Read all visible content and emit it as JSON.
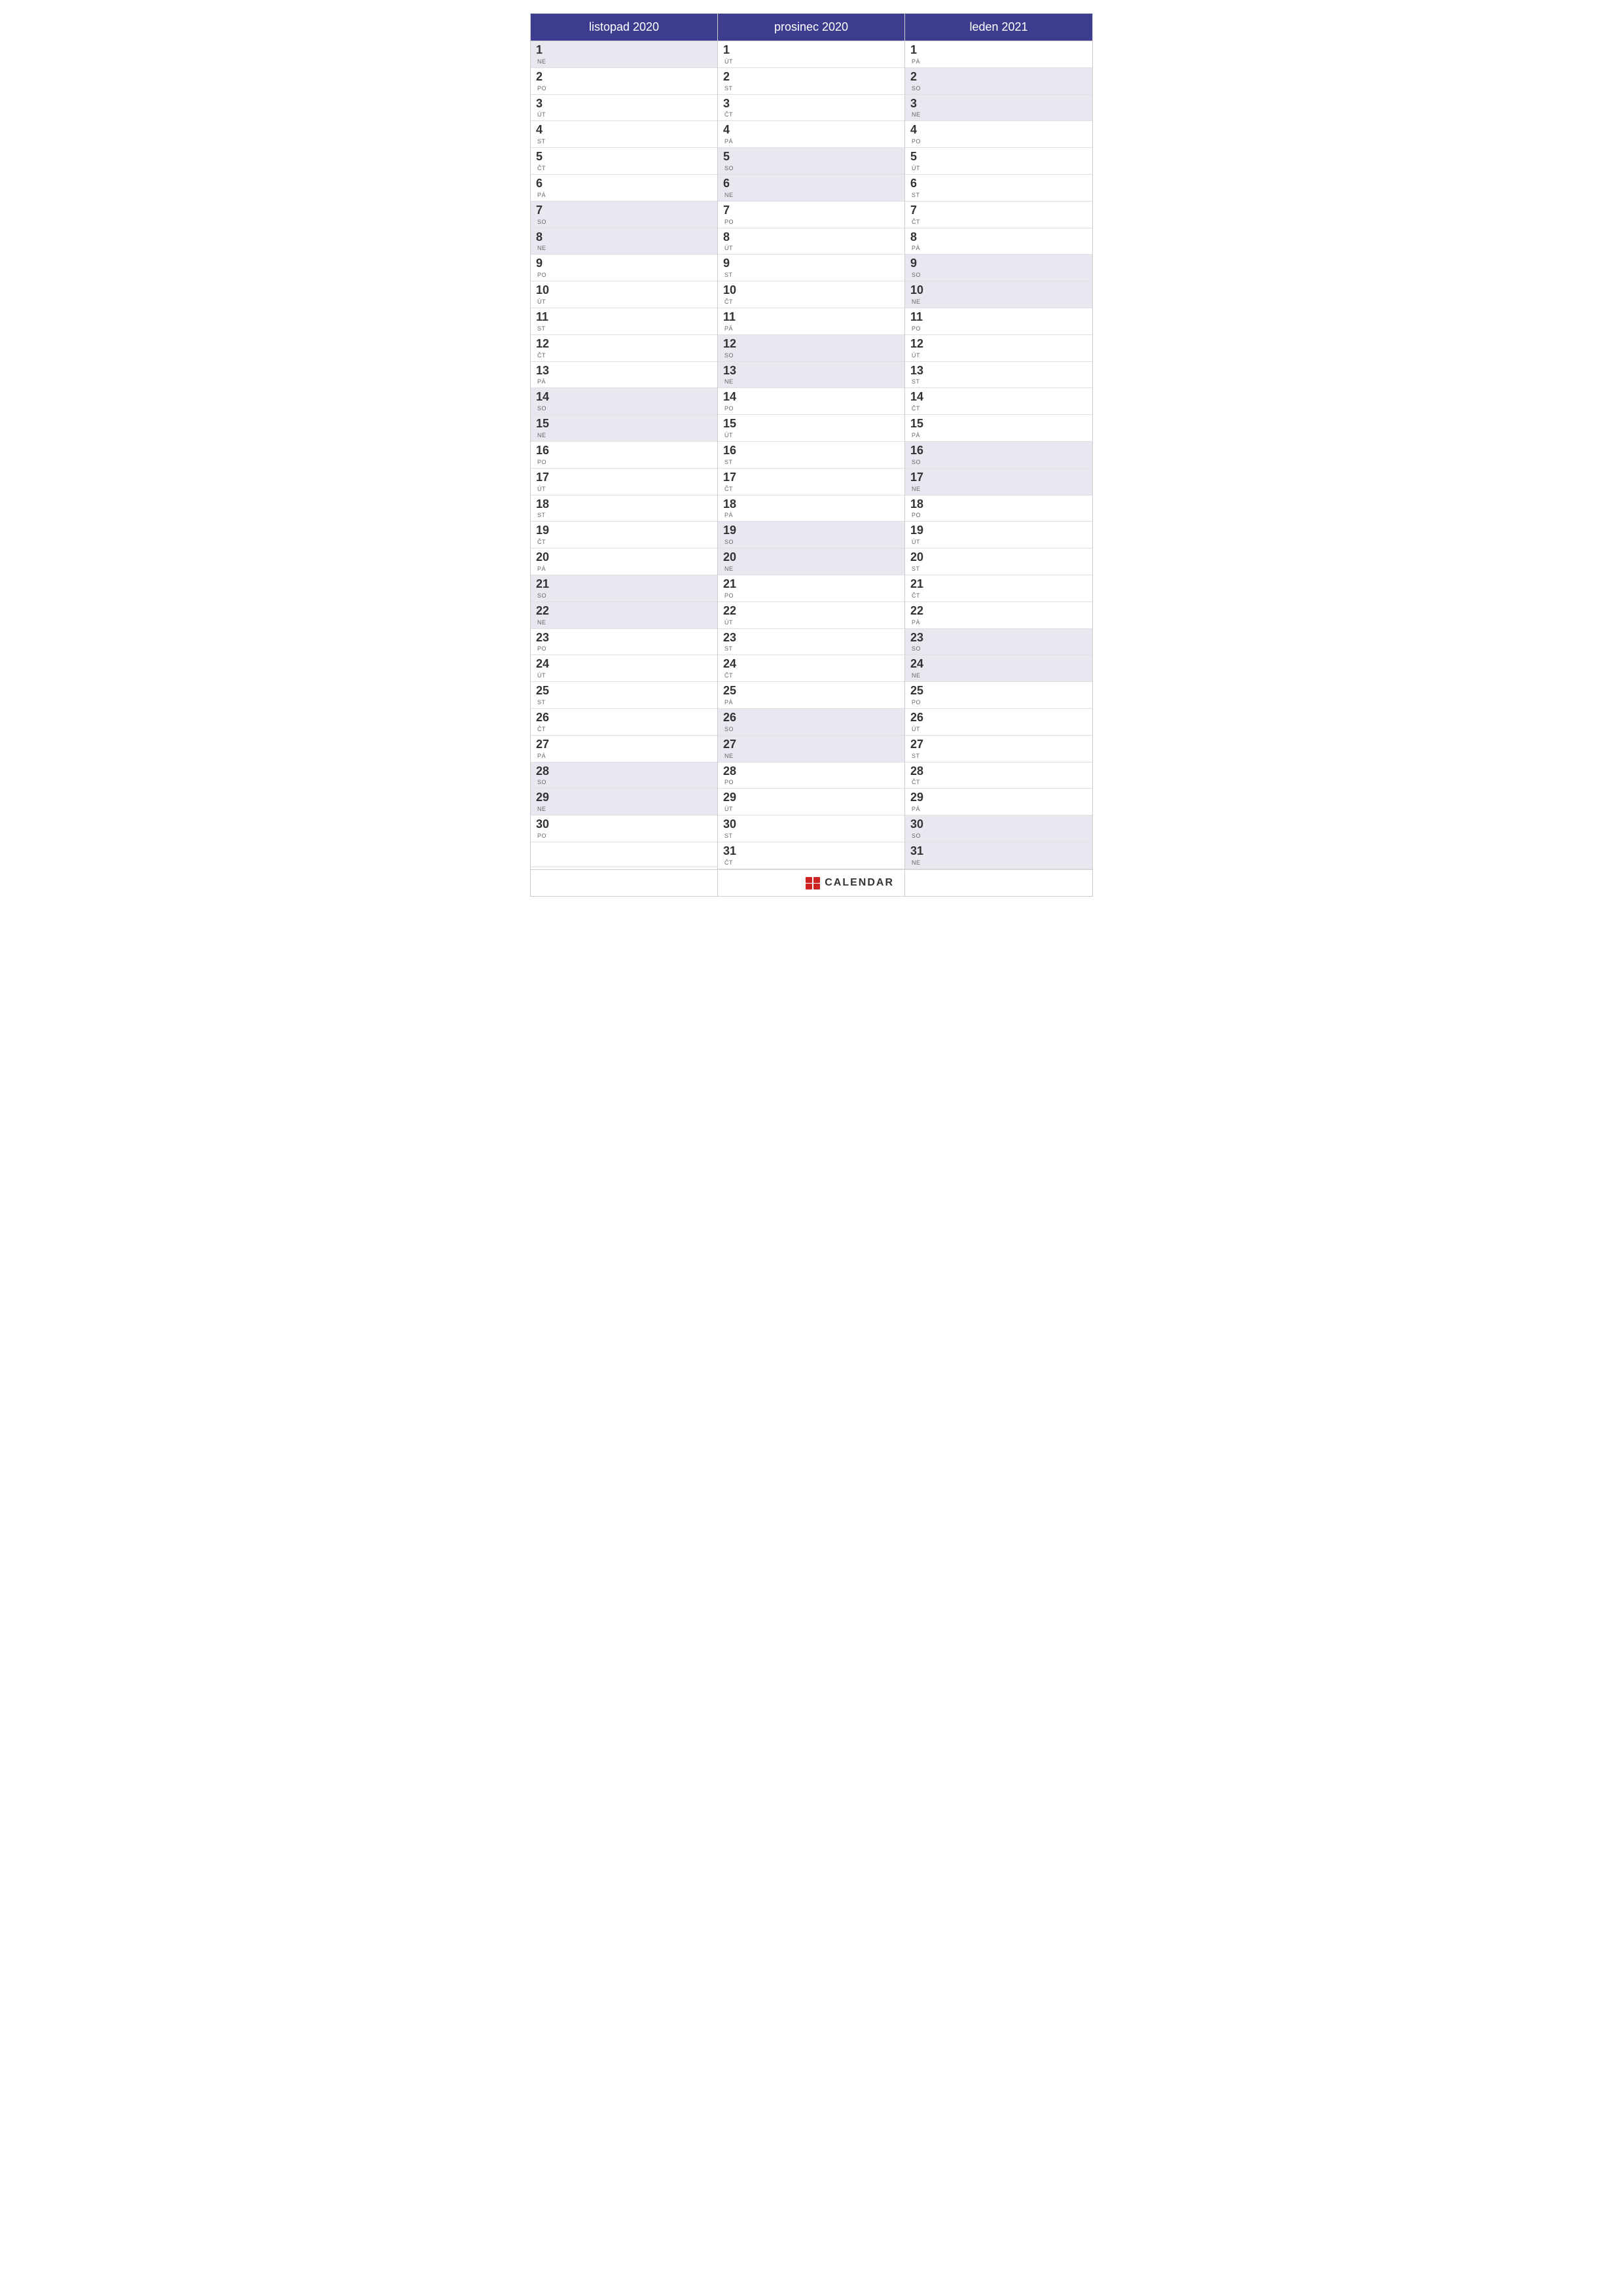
{
  "months": [
    {
      "name": "listopad 2020",
      "days": [
        {
          "num": "1",
          "name": "NE",
          "weekend": true
        },
        {
          "num": "2",
          "name": "PO",
          "weekend": false
        },
        {
          "num": "3",
          "name": "ÚT",
          "weekend": false
        },
        {
          "num": "4",
          "name": "ST",
          "weekend": false
        },
        {
          "num": "5",
          "name": "ČT",
          "weekend": false
        },
        {
          "num": "6",
          "name": "PÁ",
          "weekend": false
        },
        {
          "num": "7",
          "name": "SO",
          "weekend": true
        },
        {
          "num": "8",
          "name": "NE",
          "weekend": true
        },
        {
          "num": "9",
          "name": "PO",
          "weekend": false
        },
        {
          "num": "10",
          "name": "ÚT",
          "weekend": false
        },
        {
          "num": "11",
          "name": "ST",
          "weekend": false
        },
        {
          "num": "12",
          "name": "ČT",
          "weekend": false
        },
        {
          "num": "13",
          "name": "PÁ",
          "weekend": false
        },
        {
          "num": "14",
          "name": "SO",
          "weekend": true
        },
        {
          "num": "15",
          "name": "NE",
          "weekend": true
        },
        {
          "num": "16",
          "name": "PO",
          "weekend": false
        },
        {
          "num": "17",
          "name": "ÚT",
          "weekend": false
        },
        {
          "num": "18",
          "name": "ST",
          "weekend": false
        },
        {
          "num": "19",
          "name": "ČT",
          "weekend": false
        },
        {
          "num": "20",
          "name": "PÁ",
          "weekend": false
        },
        {
          "num": "21",
          "name": "SO",
          "weekend": true
        },
        {
          "num": "22",
          "name": "NE",
          "weekend": true
        },
        {
          "num": "23",
          "name": "PO",
          "weekend": false
        },
        {
          "num": "24",
          "name": "ÚT",
          "weekend": false
        },
        {
          "num": "25",
          "name": "ST",
          "weekend": false
        },
        {
          "num": "26",
          "name": "ČT",
          "weekend": false
        },
        {
          "num": "27",
          "name": "PÁ",
          "weekend": false
        },
        {
          "num": "28",
          "name": "SO",
          "weekend": true
        },
        {
          "num": "29",
          "name": "NE",
          "weekend": true
        },
        {
          "num": "30",
          "name": "PO",
          "weekend": false
        }
      ],
      "extraDays": 1
    },
    {
      "name": "prosinec 2020",
      "days": [
        {
          "num": "1",
          "name": "ÚT",
          "weekend": false
        },
        {
          "num": "2",
          "name": "ST",
          "weekend": false
        },
        {
          "num": "3",
          "name": "ČT",
          "weekend": false
        },
        {
          "num": "4",
          "name": "PÁ",
          "weekend": false
        },
        {
          "num": "5",
          "name": "SO",
          "weekend": true
        },
        {
          "num": "6",
          "name": "NE",
          "weekend": true
        },
        {
          "num": "7",
          "name": "PO",
          "weekend": false
        },
        {
          "num": "8",
          "name": "ÚT",
          "weekend": false
        },
        {
          "num": "9",
          "name": "ST",
          "weekend": false
        },
        {
          "num": "10",
          "name": "ČT",
          "weekend": false
        },
        {
          "num": "11",
          "name": "PÁ",
          "weekend": false
        },
        {
          "num": "12",
          "name": "SO",
          "weekend": true
        },
        {
          "num": "13",
          "name": "NE",
          "weekend": true
        },
        {
          "num": "14",
          "name": "PO",
          "weekend": false
        },
        {
          "num": "15",
          "name": "ÚT",
          "weekend": false
        },
        {
          "num": "16",
          "name": "ST",
          "weekend": false
        },
        {
          "num": "17",
          "name": "ČT",
          "weekend": false
        },
        {
          "num": "18",
          "name": "PÁ",
          "weekend": false
        },
        {
          "num": "19",
          "name": "SO",
          "weekend": true
        },
        {
          "num": "20",
          "name": "NE",
          "weekend": true
        },
        {
          "num": "21",
          "name": "PO",
          "weekend": false
        },
        {
          "num": "22",
          "name": "ÚT",
          "weekend": false
        },
        {
          "num": "23",
          "name": "ST",
          "weekend": false
        },
        {
          "num": "24",
          "name": "ČT",
          "weekend": false
        },
        {
          "num": "25",
          "name": "PÁ",
          "weekend": false
        },
        {
          "num": "26",
          "name": "SO",
          "weekend": true
        },
        {
          "num": "27",
          "name": "NE",
          "weekend": true
        },
        {
          "num": "28",
          "name": "PO",
          "weekend": false
        },
        {
          "num": "29",
          "name": "ÚT",
          "weekend": false
        },
        {
          "num": "30",
          "name": "ST",
          "weekend": false
        },
        {
          "num": "31",
          "name": "ČT",
          "weekend": false
        }
      ],
      "extraDays": 0
    },
    {
      "name": "leden 2021",
      "days": [
        {
          "num": "1",
          "name": "PÁ",
          "weekend": false
        },
        {
          "num": "2",
          "name": "SO",
          "weekend": true
        },
        {
          "num": "3",
          "name": "NE",
          "weekend": true
        },
        {
          "num": "4",
          "name": "PO",
          "weekend": false
        },
        {
          "num": "5",
          "name": "ÚT",
          "weekend": false
        },
        {
          "num": "6",
          "name": "ST",
          "weekend": false
        },
        {
          "num": "7",
          "name": "ČT",
          "weekend": false
        },
        {
          "num": "8",
          "name": "PÁ",
          "weekend": false
        },
        {
          "num": "9",
          "name": "SO",
          "weekend": true
        },
        {
          "num": "10",
          "name": "NE",
          "weekend": true
        },
        {
          "num": "11",
          "name": "PO",
          "weekend": false
        },
        {
          "num": "12",
          "name": "ÚT",
          "weekend": false
        },
        {
          "num": "13",
          "name": "ST",
          "weekend": false
        },
        {
          "num": "14",
          "name": "ČT",
          "weekend": false
        },
        {
          "num": "15",
          "name": "PÁ",
          "weekend": false
        },
        {
          "num": "16",
          "name": "SO",
          "weekend": true
        },
        {
          "num": "17",
          "name": "NE",
          "weekend": true
        },
        {
          "num": "18",
          "name": "PO",
          "weekend": false
        },
        {
          "num": "19",
          "name": "ÚT",
          "weekend": false
        },
        {
          "num": "20",
          "name": "ST",
          "weekend": false
        },
        {
          "num": "21",
          "name": "ČT",
          "weekend": false
        },
        {
          "num": "22",
          "name": "PÁ",
          "weekend": false
        },
        {
          "num": "23",
          "name": "SO",
          "weekend": true
        },
        {
          "num": "24",
          "name": "NE",
          "weekend": true
        },
        {
          "num": "25",
          "name": "PO",
          "weekend": false
        },
        {
          "num": "26",
          "name": "ÚT",
          "weekend": false
        },
        {
          "num": "27",
          "name": "ST",
          "weekend": false
        },
        {
          "num": "28",
          "name": "ČT",
          "weekend": false
        },
        {
          "num": "29",
          "name": "PÁ",
          "weekend": false
        },
        {
          "num": "30",
          "name": "SO",
          "weekend": true
        },
        {
          "num": "31",
          "name": "NE",
          "weekend": true
        }
      ],
      "extraDays": 0
    }
  ],
  "footer": {
    "logo_text": "CALENDAR"
  }
}
